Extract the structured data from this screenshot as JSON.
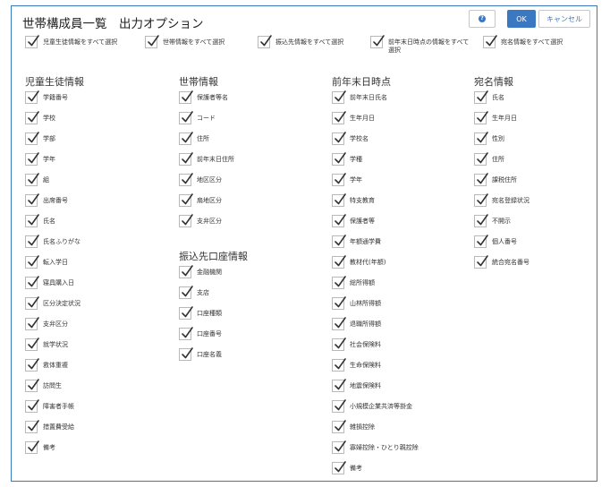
{
  "dialog": {
    "title": "世帯構成員一覧　出力オプション",
    "help_label": "?",
    "ok_label": "OK",
    "cancel_label": "キャンセル"
  },
  "select_all": [
    "児童生徒情報をすべて選択",
    "世帯情報をすべて選択",
    "振込先情報をすべて選択",
    "前年末日時点の情報をすべて選択",
    "宛名情報をすべて選択"
  ],
  "sections": {
    "student": {
      "title": "児童生徒情報",
      "items": [
        "学籍番号",
        "学校",
        "学部",
        "学年",
        "組",
        "出席番号",
        "氏名",
        "氏名ふりがな",
        "転入学日",
        "寝具購入日",
        "区分決定状況",
        "支弁区分",
        "就学状況",
        "救体重複",
        "訪問生",
        "障害者手帳",
        "措置費受給",
        "備考"
      ]
    },
    "household": {
      "title": "世帯情報",
      "items": [
        "保護者等名",
        "コード",
        "住所",
        "前年末日住所",
        "地区区分",
        "扇地区分",
        "支弁区分"
      ]
    },
    "bank": {
      "title": "振込先口座情報",
      "items": [
        "金融機関",
        "支店",
        "口座種類",
        "口座番号",
        "口座名義"
      ]
    },
    "prev_year": {
      "title": "前年末日時点",
      "items": [
        "前年末日氏名",
        "生年月日",
        "学校名",
        "学種",
        "学年",
        "特支教育",
        "保護者等",
        "年額通学費",
        "教材代(年額)",
        "総所得額",
        "山林所得額",
        "退職所得額",
        "社会保険料",
        "生命保険料",
        "地震保険料",
        "小規模企業共済等掛金",
        "雑損控除",
        "寡婦控除・ひとり親控除",
        "備考"
      ]
    },
    "address": {
      "title": "宛名情報",
      "items": [
        "氏名",
        "生年月日",
        "性別",
        "住所",
        "課税住所",
        "宛名登録状況",
        "不開示",
        "個人番号",
        "統合宛名番号"
      ]
    }
  }
}
